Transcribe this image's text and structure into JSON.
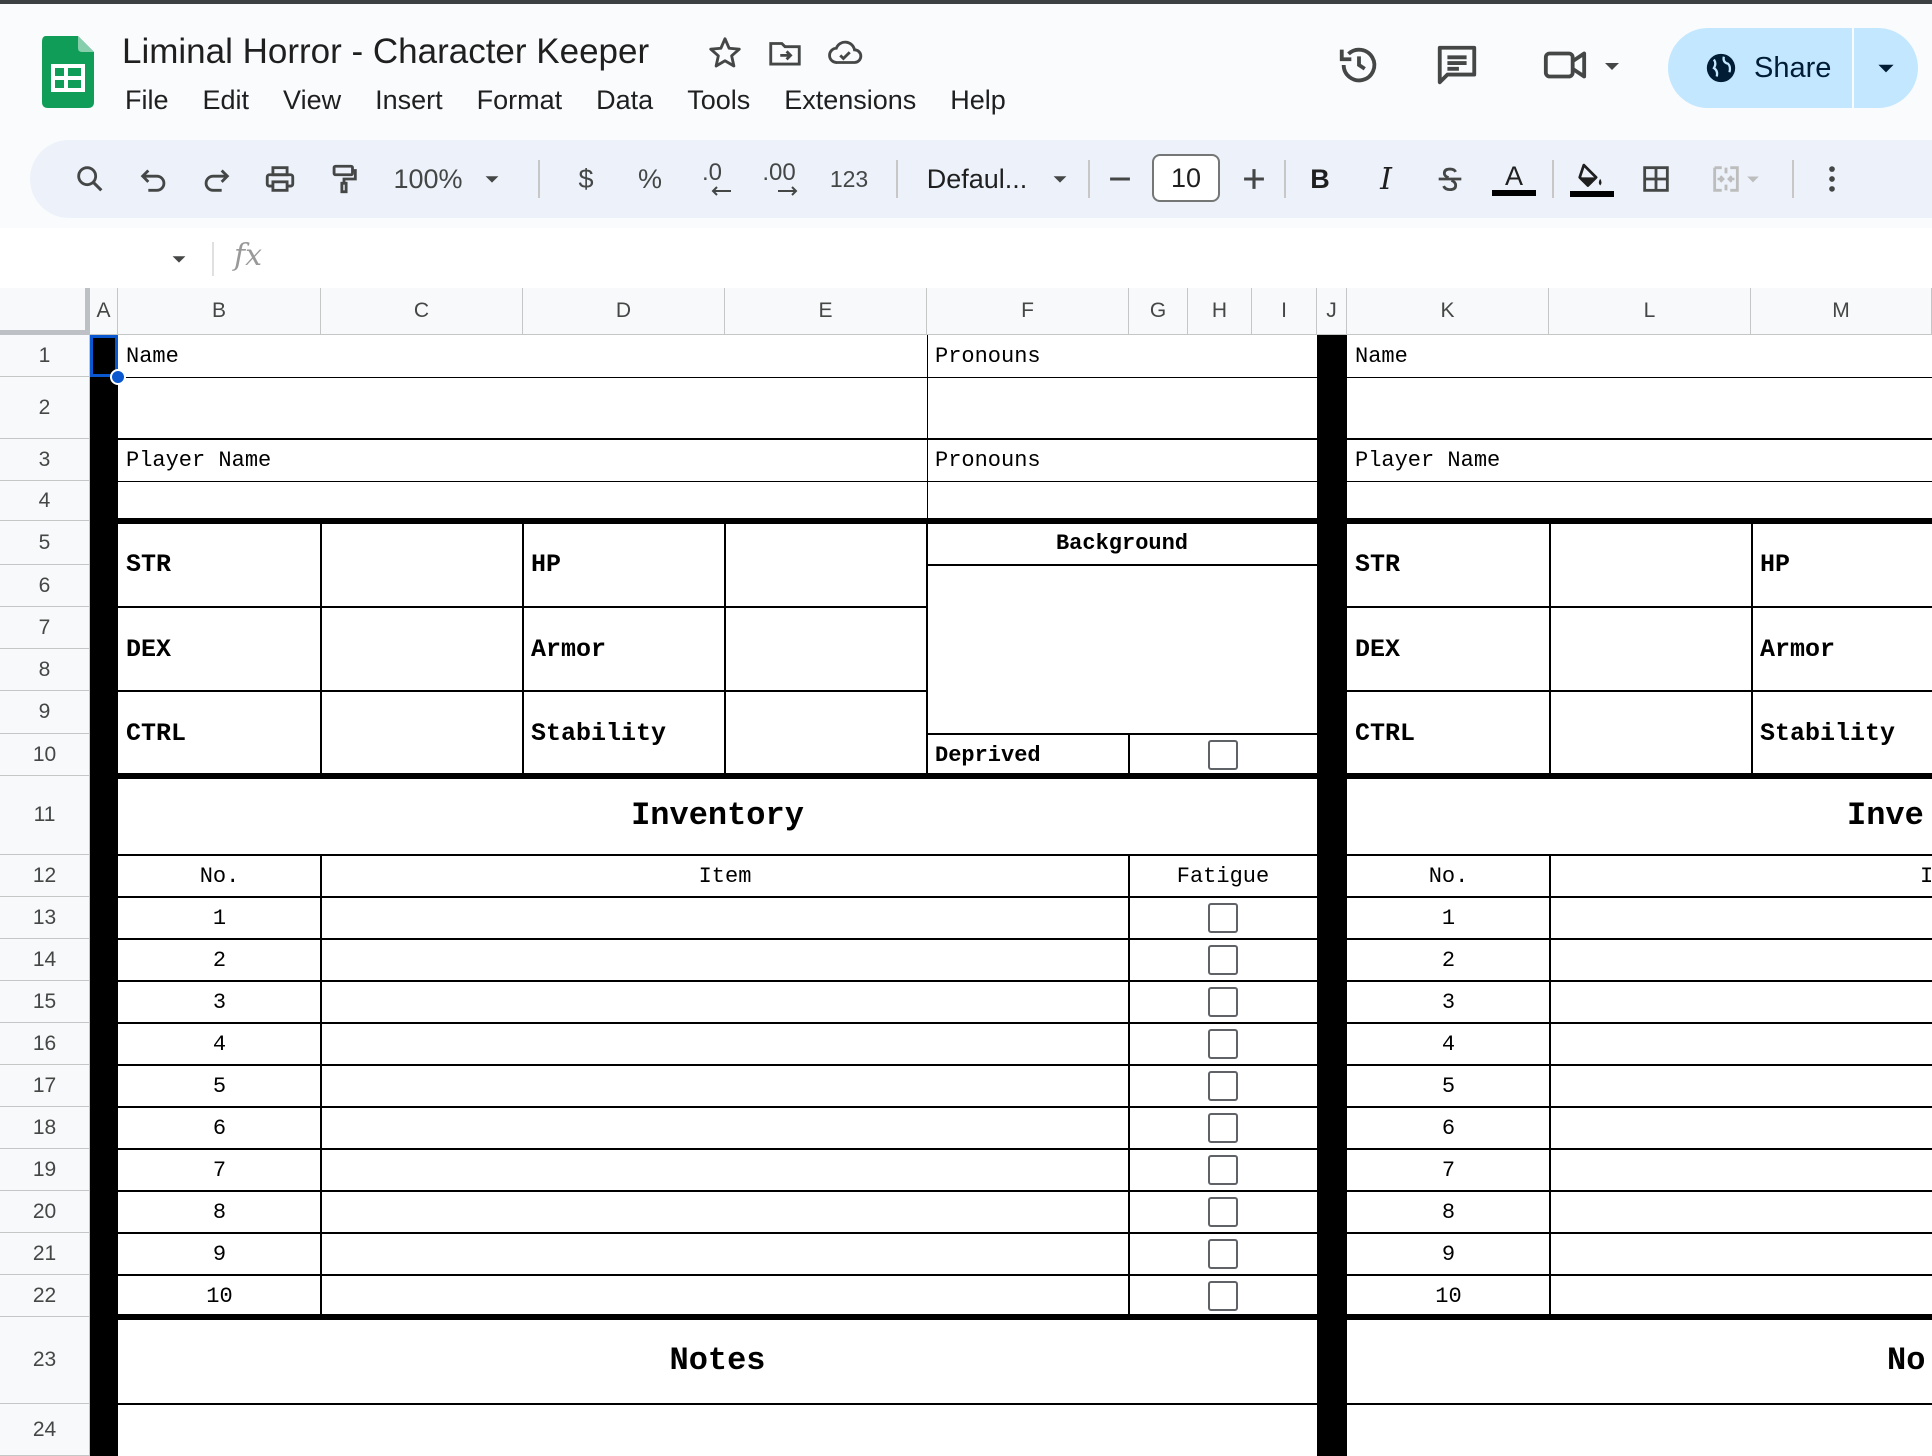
{
  "app": {
    "title": "Liminal Horror - Character Keeper",
    "menu": [
      "File",
      "Edit",
      "View",
      "Insert",
      "Format",
      "Data",
      "Tools",
      "Extensions",
      "Help"
    ],
    "share_label": "Share"
  },
  "toolbar": {
    "zoom": "100%",
    "currency": "$",
    "percent": "%",
    "decrease_decimal": ".0",
    "increase_decimal": ".00",
    "number_format": "123",
    "font": "Defaul...",
    "font_size": "10"
  },
  "formula": {
    "fx": "fx"
  },
  "columns": [
    "A",
    "B",
    "C",
    "D",
    "E",
    "F",
    "G",
    "H",
    "I",
    "J",
    "K",
    "L",
    "M"
  ],
  "rows": [
    "1",
    "2",
    "3",
    "4",
    "5",
    "6",
    "7",
    "8",
    "9",
    "10",
    "11",
    "12",
    "13",
    "14",
    "15",
    "16",
    "17",
    "18",
    "19",
    "20",
    "21",
    "22",
    "23",
    "24"
  ],
  "sheet": {
    "name_label": "Name",
    "pronouns_label": "Pronouns",
    "player_name_label": "Player Name",
    "str_label": "STR",
    "hp_label": "HP",
    "dex_label": "DEX",
    "armor_label": "Armor",
    "ctrl_label": "CTRL",
    "stability_label": "Stability",
    "background_label": "Background",
    "deprived_label": "Deprived",
    "inventory_title": "Inventory",
    "inventory_title_cut": "Inve",
    "no_header": "No.",
    "item_header": "Item",
    "item_header_cut": "I",
    "fatigue_header": "Fatigue",
    "item_numbers": [
      "1",
      "2",
      "3",
      "4",
      "5",
      "6",
      "7",
      "8",
      "9",
      "10"
    ],
    "notes_title": "Notes",
    "notes_title_cut": "No"
  },
  "colors": {
    "accent": "#0b57d0",
    "share_bg": "#c2e7ff",
    "toolbar_bg": "#edf2fa",
    "sheets_green": "#0f9d58"
  }
}
